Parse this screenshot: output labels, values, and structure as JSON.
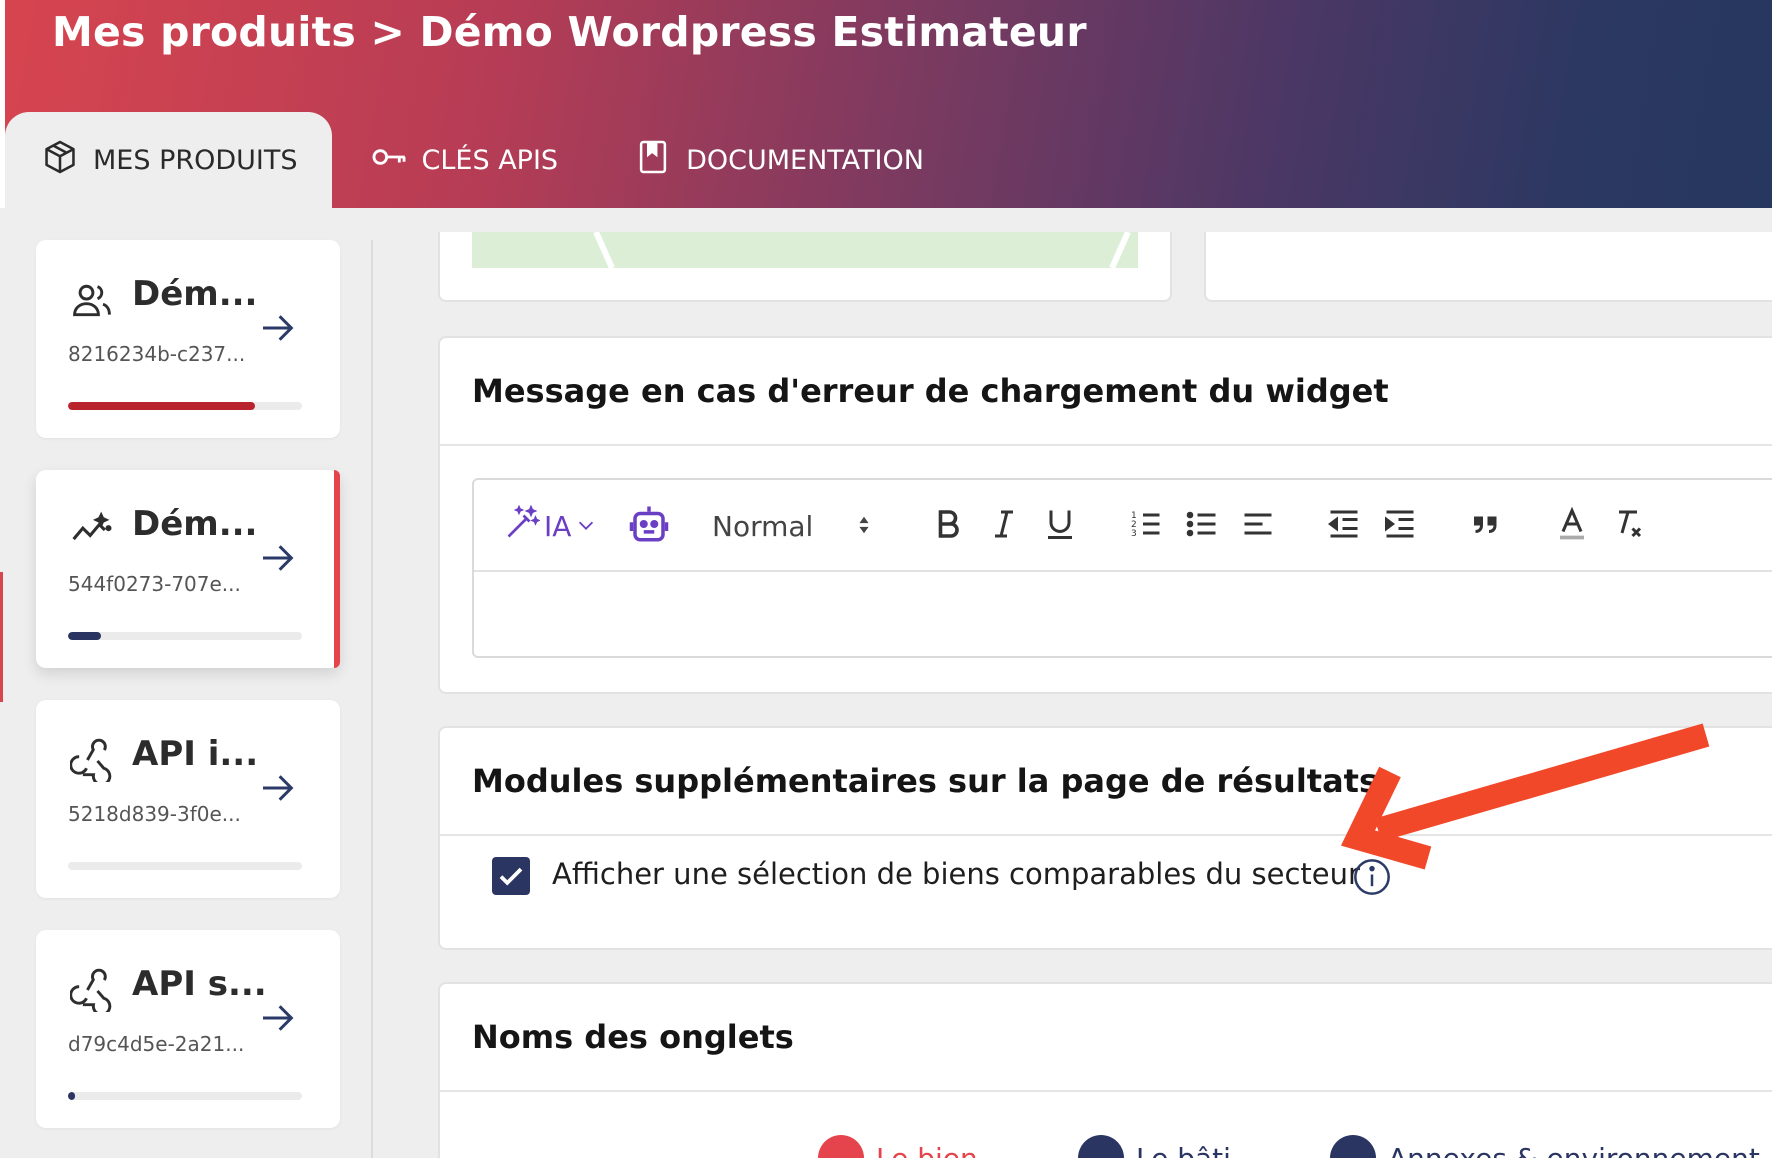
{
  "header": {
    "breadcrumb": "Mes produits > Démo Wordpress Estimateur",
    "tabs": [
      {
        "label": "MES PRODUITS",
        "icon": "box-icon",
        "active": true
      },
      {
        "label": "CLÉS APIS",
        "icon": "key-icon",
        "active": false
      },
      {
        "label": "DOCUMENTATION",
        "icon": "book-icon",
        "active": false
      }
    ]
  },
  "sidebar": {
    "products": [
      {
        "name": "Dém...",
        "id": "8216234b-c237...",
        "icon": "users-icon",
        "progress": 0.8,
        "progress_color": "#b8232e",
        "selected": false
      },
      {
        "name": "Dém...",
        "id": "544f0273-707e...",
        "icon": "trend-sparkle-icon",
        "progress": 0.14,
        "progress_color": "#2b3562",
        "selected": true
      },
      {
        "name": "API i...",
        "id": "5218d839-3f0e...",
        "icon": "webhook-icon",
        "progress": 0,
        "progress_color": "#2b3562",
        "selected": false
      },
      {
        "name": "API s...",
        "id": "d79c4d5e-2a21...",
        "icon": "webhook-icon",
        "progress": 0.03,
        "progress_color": "#2b3562",
        "selected": false
      }
    ]
  },
  "main": {
    "error_message_section": {
      "title": "Message en cas d'erreur de chargement du widget",
      "editor": {
        "ai_label": "IA",
        "format_select": "Normal",
        "content": ""
      }
    },
    "modules_section": {
      "title": "Modules supplémentaires sur la page de résultats",
      "checkbox_label": "Afficher une sélection de biens comparables du secteur",
      "checked": true
    },
    "tabs_names_section": {
      "title": "Noms des onglets",
      "tabs": [
        {
          "label": "Le bien",
          "color": "#e5444c"
        },
        {
          "label": "Le bâti",
          "color": "#2b3562"
        },
        {
          "label": "Annexes & environnement",
          "color": "#2b3562"
        }
      ]
    }
  },
  "colors": {
    "accent": "#e5444c",
    "navy": "#2b3562",
    "annotation_arrow": "#f2482a"
  }
}
